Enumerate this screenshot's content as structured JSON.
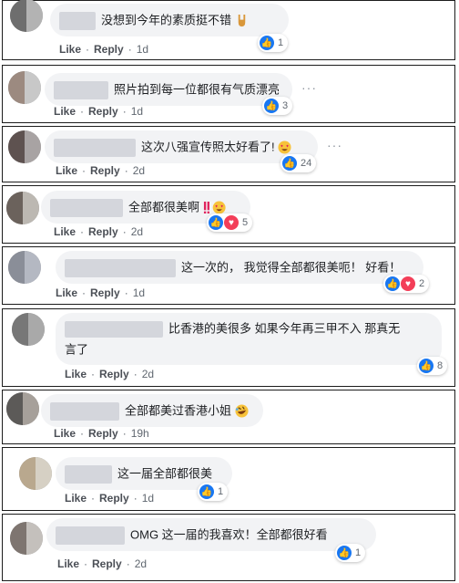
{
  "ui": {
    "like_label": "Like",
    "reply_label": "Reply",
    "more_label": "···"
  },
  "colors": {
    "like_blue": "#1877f2",
    "love_red": "#f33e58",
    "bubble_bg": "#f2f3f5"
  },
  "comments": [
    {
      "text": "没想到今年的素质挺不错",
      "emoji": "rock-on-hand-emoji",
      "time": "1d",
      "reactions": [
        "like"
      ],
      "count": "1"
    },
    {
      "text": "照片拍到每一位都很有气质漂亮",
      "emoji": "",
      "time": "1d",
      "reactions": [
        "like"
      ],
      "count": "3"
    },
    {
      "text": "这次八强宣传照太好看了!",
      "emoji": "heart-eyes-emoji",
      "time": "2d",
      "reactions": [
        "like"
      ],
      "count": "24"
    },
    {
      "text": "全部都很美啊",
      "emoji": "double-exclamation-heart-eyes-emoji",
      "time": "2d",
      "reactions": [
        "like",
        "love"
      ],
      "count": "5"
    },
    {
      "text": "这一次的， 我觉得全部都很美呃！ 好看！",
      "emoji": "",
      "time": "1d",
      "reactions": [
        "like",
        "love"
      ],
      "count": "2"
    },
    {
      "text_line1": "比香港的美很多 如果今年再三甲不入 那真无",
      "text_line2": "言了",
      "emoji": "",
      "time": "2d",
      "reactions": [
        "like"
      ],
      "count": "8"
    },
    {
      "text": "全部都美过香港小姐",
      "emoji": "rofl-emoji",
      "time": "19h",
      "reactions": [
        "like"
      ],
      "count": ""
    },
    {
      "text": "这一届全部都很美",
      "emoji": "",
      "time": "1d",
      "reactions": [
        "like"
      ],
      "count": "1"
    },
    {
      "text": "OMG 这一届的我喜欢！全部都很好看",
      "emoji": "",
      "time": "2d",
      "reactions": [
        "like"
      ],
      "count": "1"
    }
  ]
}
